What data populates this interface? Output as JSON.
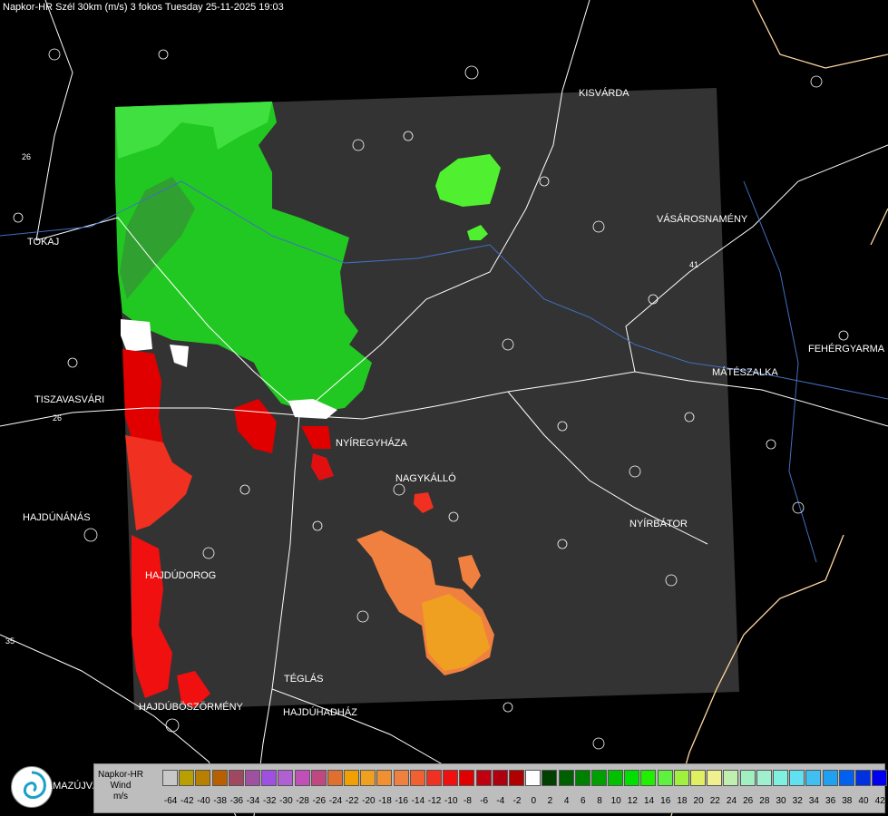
{
  "header": {
    "title": "Napkor-HR Szél 30km (m/s) 3 fokos Tuesday 25-11-2025 19:03"
  },
  "cities": [
    {
      "name": "KISVÁRDA"
    },
    {
      "name": "TOKAJ"
    },
    {
      "name": "VÁSÁROSNAMÉNY"
    },
    {
      "name": "FEHÉRGYARMA"
    },
    {
      "name": "MÁTÉSZALKA"
    },
    {
      "name": "TISZAVASVÁRI"
    },
    {
      "name": "NYÍREGYHÁZA"
    },
    {
      "name": "NAGYKÁLLÓ"
    },
    {
      "name": "HAJDÚNÁNÁS"
    },
    {
      "name": "NYÍRBÁTOR"
    },
    {
      "name": "HAJDÚDOROG"
    },
    {
      "name": "TÉGLÁS"
    },
    {
      "name": "HAJDÚBÖSZÖRMÉNY"
    },
    {
      "name": "HAJDÚHADHÁZ"
    }
  ],
  "road_numbers": [
    "26",
    "35",
    "41"
  ],
  "legend": {
    "title_line1": "Napkor-HR",
    "title_line2": "Wind",
    "title_line3": "m/s",
    "ticks": [
      "-64",
      "-42",
      "-40",
      "-38",
      "-36",
      "-34",
      "-32",
      "-30",
      "-28",
      "-26",
      "-24",
      "-22",
      "-20",
      "-18",
      "-16",
      "-14",
      "-12",
      "-10",
      "-8",
      "-6",
      "-4",
      "-2",
      "0",
      "2",
      "4",
      "6",
      "8",
      "10",
      "12",
      "14",
      "16",
      "18",
      "20",
      "22",
      "24",
      "26",
      "28",
      "30",
      "32",
      "34",
      "36",
      "38",
      "40",
      "42"
    ],
    "colors": [
      "#c8c8c8",
      "#b8a000",
      "#b88000",
      "#b86000",
      "#a04860",
      "#a050a0",
      "#a050e0",
      "#b060d0",
      "#c050b8",
      "#c04880",
      "#e07030",
      "#f0a000",
      "#f0a020",
      "#f09030",
      "#f08040",
      "#f06030",
      "#f03020",
      "#f01010",
      "#e00000",
      "#c00010",
      "#b00010",
      "#b00000",
      "#ffffff",
      "#004000",
      "#006000",
      "#008000",
      "#00a000",
      "#00c000",
      "#00e000",
      "#20f000",
      "#60f040",
      "#a0f040",
      "#e0f060",
      "#f0f090",
      "#c0f0b0",
      "#a0f0c0",
      "#a0f0d0",
      "#80f0e0",
      "#60e0f0",
      "#40c0f0",
      "#20a0f0",
      "#0060f0",
      "#0030e0",
      "#0000f0"
    ]
  },
  "logo": {
    "text": "LMAZÚJVÁR"
  }
}
